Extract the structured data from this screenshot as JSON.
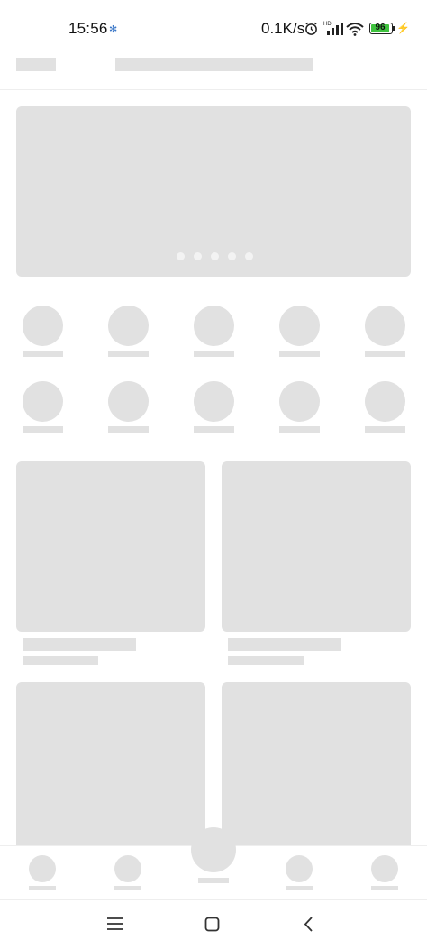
{
  "status_bar": {
    "time": "15:56",
    "net_speed": "0.1K/s",
    "battery_level": "96",
    "signal_label": "HD"
  },
  "skeleton": {
    "banner_indicator_count": 5,
    "category_rows": 2,
    "category_columns": 5,
    "card_rows": 2,
    "card_columns": 2,
    "bottom_tabs": 5
  },
  "colors": {
    "skeleton": "#e1e1e1",
    "battery_fill": "#3fc33f",
    "background": "#ffffff"
  },
  "system_nav": {
    "menu_icon": "menu-icon",
    "home_icon": "home-icon",
    "back_icon": "back-icon"
  }
}
